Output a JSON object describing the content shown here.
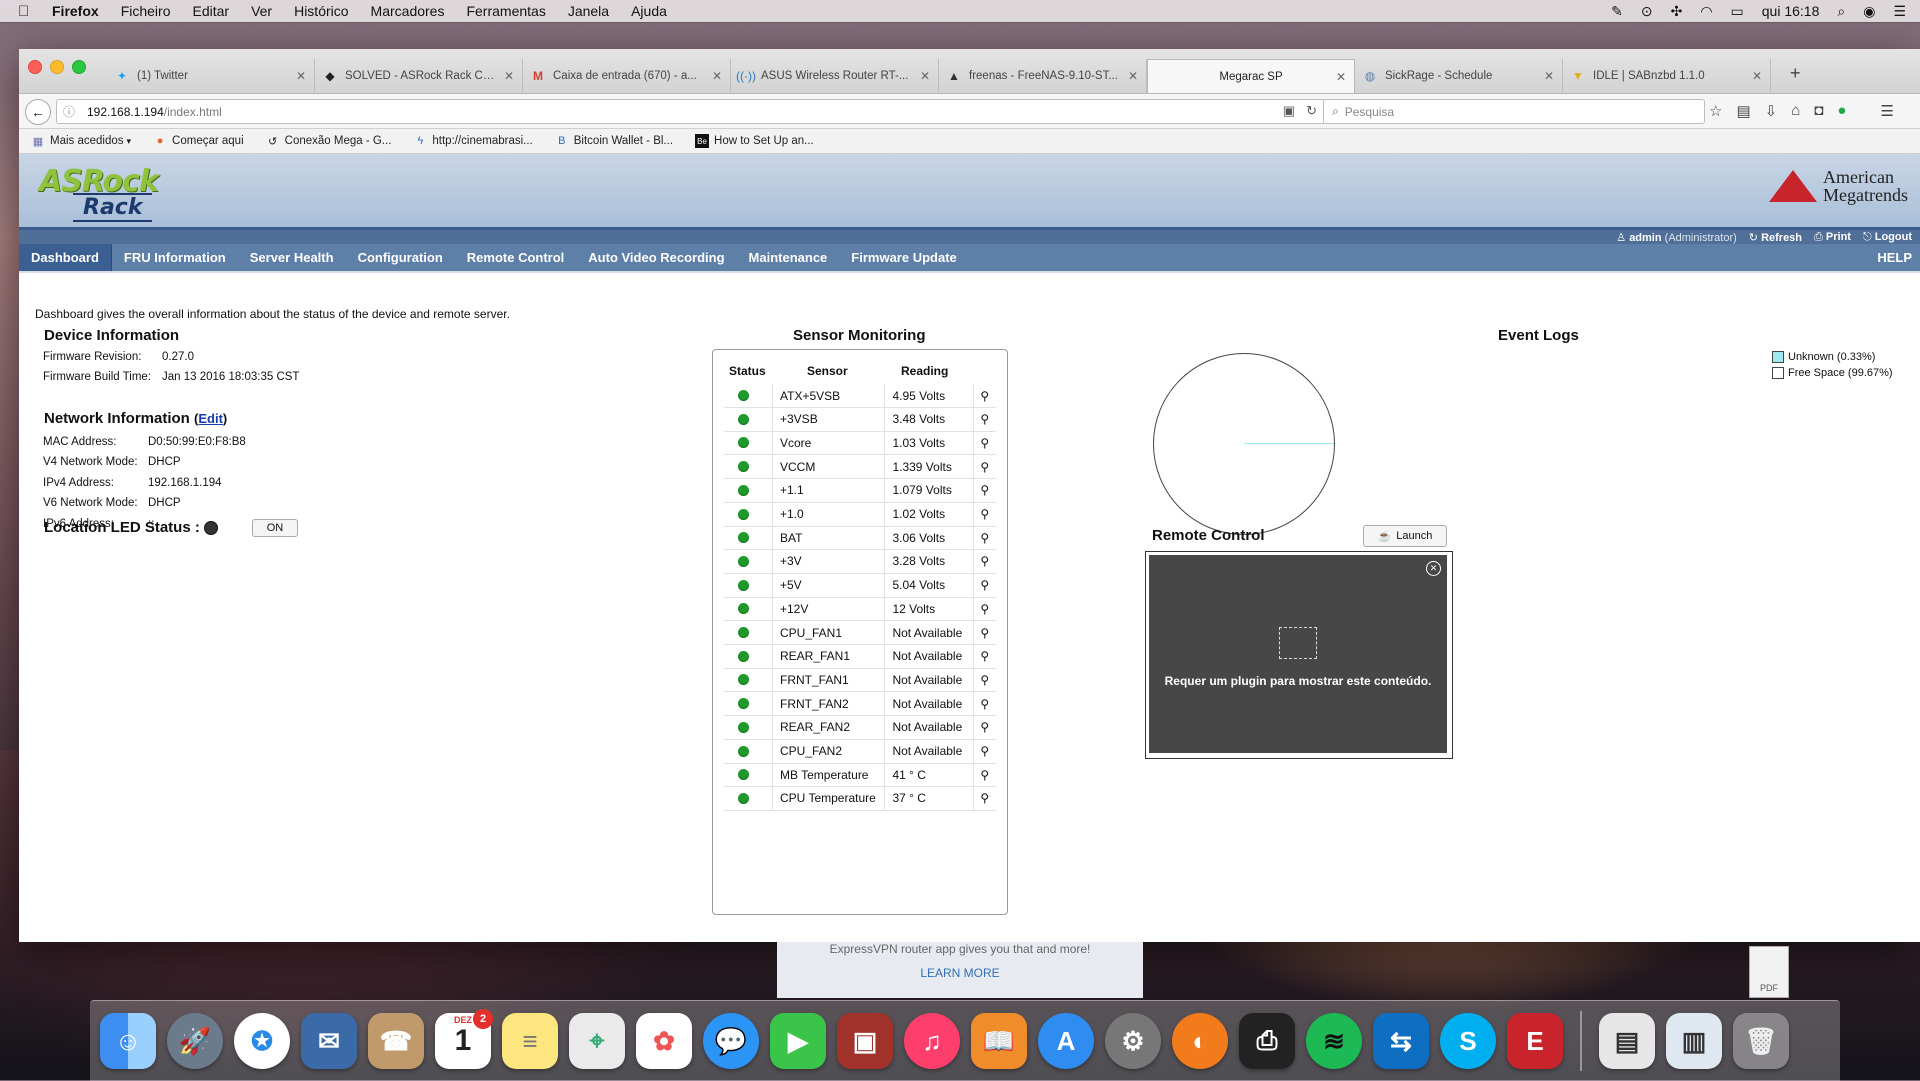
{
  "menubar": {
    "items": [
      "Firefox",
      "Ficheiro",
      "Editar",
      "Ver",
      "Histórico",
      "Marcadores",
      "Ferramentas",
      "Janela",
      "Ajuda"
    ],
    "clock": "qui 16:18"
  },
  "browser": {
    "tabs": [
      {
        "label": "(1) Twitter",
        "icon": "twitter-icon"
      },
      {
        "label": "SOLVED - ASRock Rack C2...",
        "icon": "forum-icon"
      },
      {
        "label": "Caixa de entrada (670) - a...",
        "icon": "gmail-icon"
      },
      {
        "label": "ASUS Wireless Router RT-...",
        "icon": "wifi-icon"
      },
      {
        "label": "freenas - FreeNAS-9.10-ST...",
        "icon": "shark-icon"
      },
      {
        "label": "Megarac SP",
        "icon": "",
        "active": true
      },
      {
        "label": "SickRage - Schedule",
        "icon": "globe-icon"
      },
      {
        "label": "IDLE | SABnzbd 1.1.0",
        "icon": "download-icon"
      }
    ],
    "url_host": "192.168.1.194",
    "url_path": "/index.html",
    "search_placeholder": "Pesquisa",
    "bookmarks": [
      "Mais acedidos",
      "Começar aqui",
      "Conexão Mega - G...",
      "http://cinemabrasi...",
      "Bitcoin Wallet - Bl...",
      "How to Set Up an..."
    ]
  },
  "header": {
    "logo_line1": "ASRock",
    "logo_line2": "Rack",
    "ami_line1": "American",
    "ami_line2": "Megatrends"
  },
  "userbar": {
    "user": "admin",
    "role": "(Administrator)",
    "refresh": "Refresh",
    "print": "Print",
    "logout": "Logout"
  },
  "nav": {
    "items": [
      "Dashboard",
      "FRU Information",
      "Server Health",
      "Configuration",
      "Remote Control",
      "Auto Video Recording",
      "Maintenance",
      "Firmware Update"
    ],
    "help": "HELP"
  },
  "intro": "Dashboard gives the overall information about the status of the device and remote server.",
  "device": {
    "title": "Device Information",
    "firmware_revision_label": "Firmware Revision:",
    "firmware_revision": "0.27.0",
    "firmware_build_label": "Firmware Build Time:",
    "firmware_build": "Jan 13 2016 18:03:35 CST"
  },
  "network": {
    "title": "Network Information",
    "edit": "Edit",
    "rows": [
      {
        "label": "MAC Address:",
        "value": "D0:50:99:E0:F8:B8"
      },
      {
        "label": "V4 Network Mode:",
        "value": "DHCP"
      },
      {
        "label": "IPv4 Address:",
        "value": "192.168.1.194"
      },
      {
        "label": "V6 Network Mode:",
        "value": "DHCP"
      },
      {
        "label": "IPv6 Address:",
        "value": "::"
      }
    ]
  },
  "led": {
    "label": "Location LED Status :",
    "button": "ON"
  },
  "sensors": {
    "title": "Sensor Monitoring",
    "headers": [
      "Status",
      "Sensor",
      "Reading"
    ],
    "rows": [
      {
        "sensor": "ATX+5VSB",
        "reading": "4.95 Volts"
      },
      {
        "sensor": "+3VSB",
        "reading": "3.48 Volts"
      },
      {
        "sensor": "Vcore",
        "reading": "1.03 Volts"
      },
      {
        "sensor": "VCCM",
        "reading": "1.339 Volts"
      },
      {
        "sensor": "+1.1",
        "reading": "1.079 Volts"
      },
      {
        "sensor": "+1.0",
        "reading": "1.02 Volts"
      },
      {
        "sensor": "BAT",
        "reading": "3.06 Volts"
      },
      {
        "sensor": "+3V",
        "reading": "3.28 Volts"
      },
      {
        "sensor": "+5V",
        "reading": "5.04 Volts"
      },
      {
        "sensor": "+12V",
        "reading": "12 Volts"
      },
      {
        "sensor": "CPU_FAN1",
        "reading": "Not Available"
      },
      {
        "sensor": "REAR_FAN1",
        "reading": "Not Available"
      },
      {
        "sensor": "FRNT_FAN1",
        "reading": "Not Available"
      },
      {
        "sensor": "FRNT_FAN2",
        "reading": "Not Available"
      },
      {
        "sensor": "REAR_FAN2",
        "reading": "Not Available"
      },
      {
        "sensor": "CPU_FAN2",
        "reading": "Not Available"
      },
      {
        "sensor": "MB Temperature",
        "reading": "41 ° C"
      },
      {
        "sensor": "CPU Temperature",
        "reading": "37 ° C"
      }
    ],
    "status_color": "#1f9a2a"
  },
  "events": {
    "title": "Event Logs",
    "legend": [
      {
        "label": "Unknown (0.33%)",
        "color": "#9ee8f2"
      },
      {
        "label": "Free Space (99.67%)",
        "color": "#ffffff"
      }
    ]
  },
  "remote": {
    "title": "Remote Control",
    "launch": "Launch",
    "plugin_message": "Requer um plugin para mostrar este conteúdo."
  },
  "ad": {
    "line1": "ExpressVPN router app gives you that and more!",
    "line2": "LEARN MORE",
    "pdf": "PDF"
  },
  "dock": {
    "calendar_month": "DEZ",
    "calendar_day": "1",
    "calendar_badge": "2"
  }
}
